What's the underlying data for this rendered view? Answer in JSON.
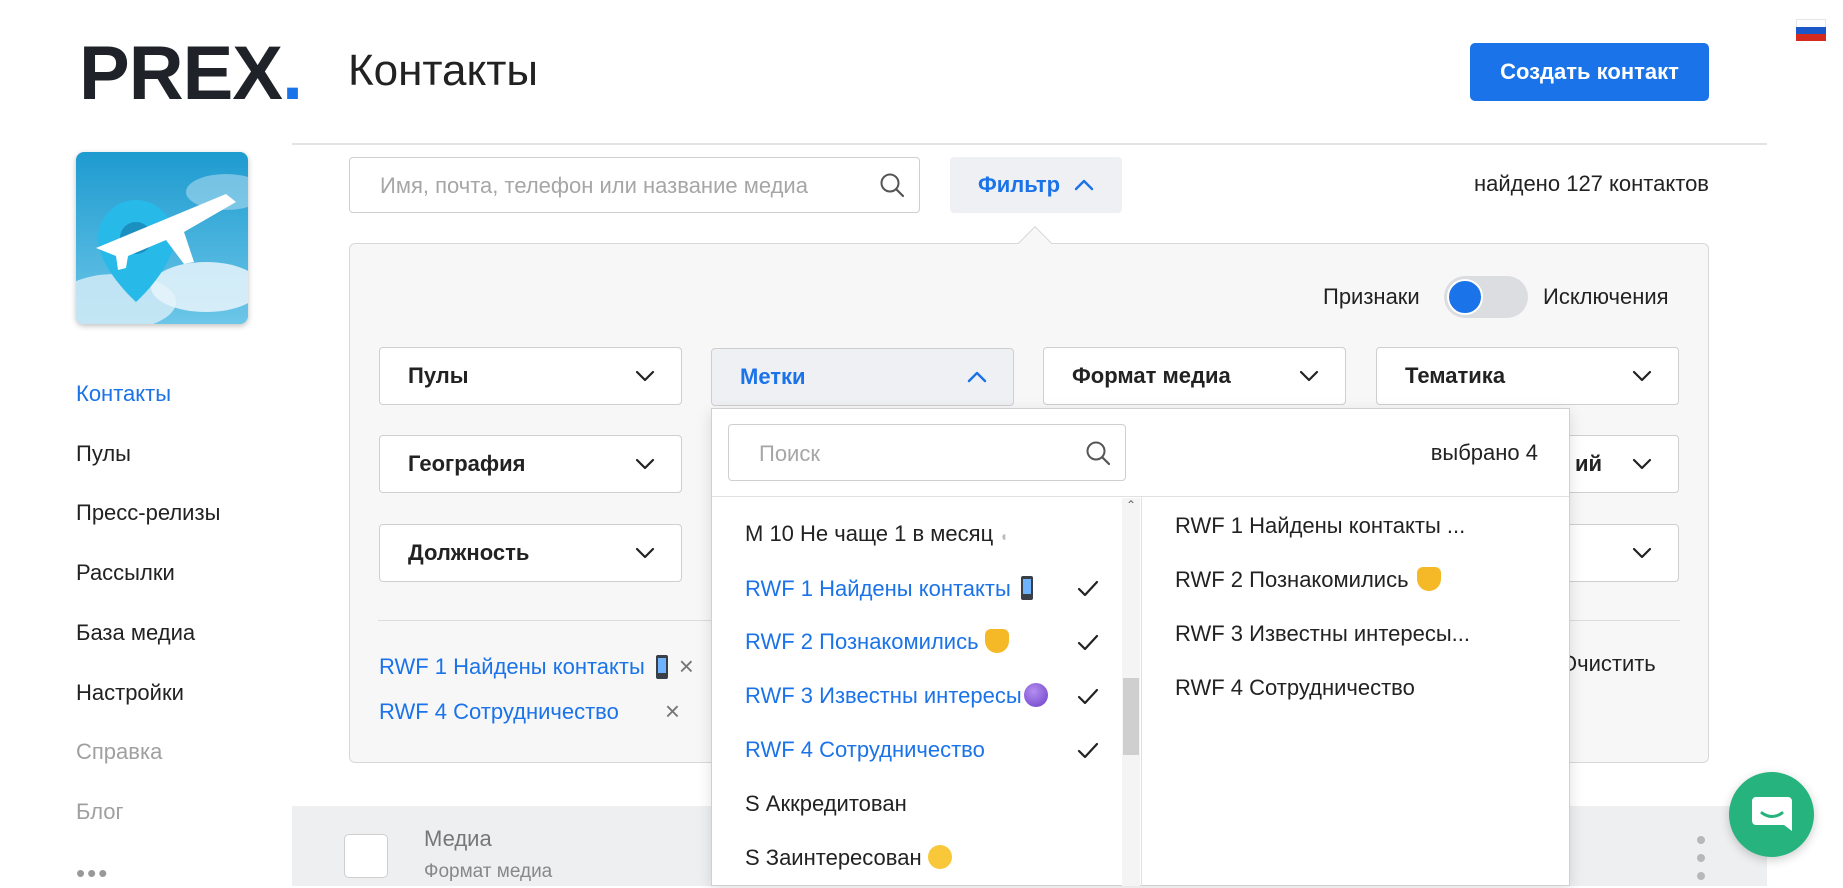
{
  "brand": {
    "name": "PREX",
    "dot": "."
  },
  "header": {
    "title": "Контакты",
    "create_button": "Создать контакт",
    "language_flag": "russian-flag"
  },
  "sidebar": {
    "items": [
      {
        "label": "Контакты",
        "state": "active"
      },
      {
        "label": "Пулы",
        "state": "normal"
      },
      {
        "label": "Пресс-релизы",
        "state": "normal"
      },
      {
        "label": "Рассылки",
        "state": "normal"
      },
      {
        "label": "База медиа",
        "state": "normal"
      },
      {
        "label": "Настройки",
        "state": "normal"
      },
      {
        "label": "Справка",
        "state": "muted"
      },
      {
        "label": "Блог",
        "state": "muted"
      }
    ],
    "more": "•••"
  },
  "search": {
    "placeholder": "Имя, почта, телефон или название медиа",
    "value": ""
  },
  "filter": {
    "button_label": "Фильтр",
    "found_prefix": "найдено",
    "found_count": "127",
    "found_suffix": "контактов"
  },
  "panel": {
    "toggle_left": "Признаки",
    "toggle_right": "Исключения",
    "dropdowns": {
      "pools": "Пулы",
      "tags": "Метки",
      "media_format": "Формат медиа",
      "topic": "Тематика",
      "geography": "География",
      "hidden_right_1": "ий",
      "position": "Должность"
    },
    "chips": [
      {
        "label": "RWF 1 Найдены контакты"
      },
      {
        "label": "RWF 4 Сотрудничество"
      }
    ],
    "clear": "Очистить"
  },
  "tags_dropdown": {
    "search_placeholder": "Поиск",
    "selected_count": "выбрано 4",
    "options": [
      {
        "label": "M 10 Не чаще 1 в месяц",
        "selected": false
      },
      {
        "label": "RWF 1 Найдены контакты",
        "selected": true
      },
      {
        "label": "RWF 2 Познакомились",
        "selected": true
      },
      {
        "label": "RWF 3 Известны интересы",
        "selected": true
      },
      {
        "label": "RWF 4 Сотрудничество",
        "selected": true
      },
      {
        "label": "S Аккредитован",
        "selected": false
      },
      {
        "label": "S Заинтересован",
        "selected": false
      }
    ],
    "selected_list": [
      "RWF 1 Найдены контакты ...",
      "RWF 2 Познакомились",
      "RWF 3 Известны интересы...",
      "RWF 4 Сотрудничество"
    ]
  },
  "table": {
    "col_media": "Медиа",
    "col_format": "Формат медиа"
  },
  "colors": {
    "accent": "#1a73e8",
    "chat": "#26b37e",
    "panel_bg": "#f7f7f7"
  }
}
